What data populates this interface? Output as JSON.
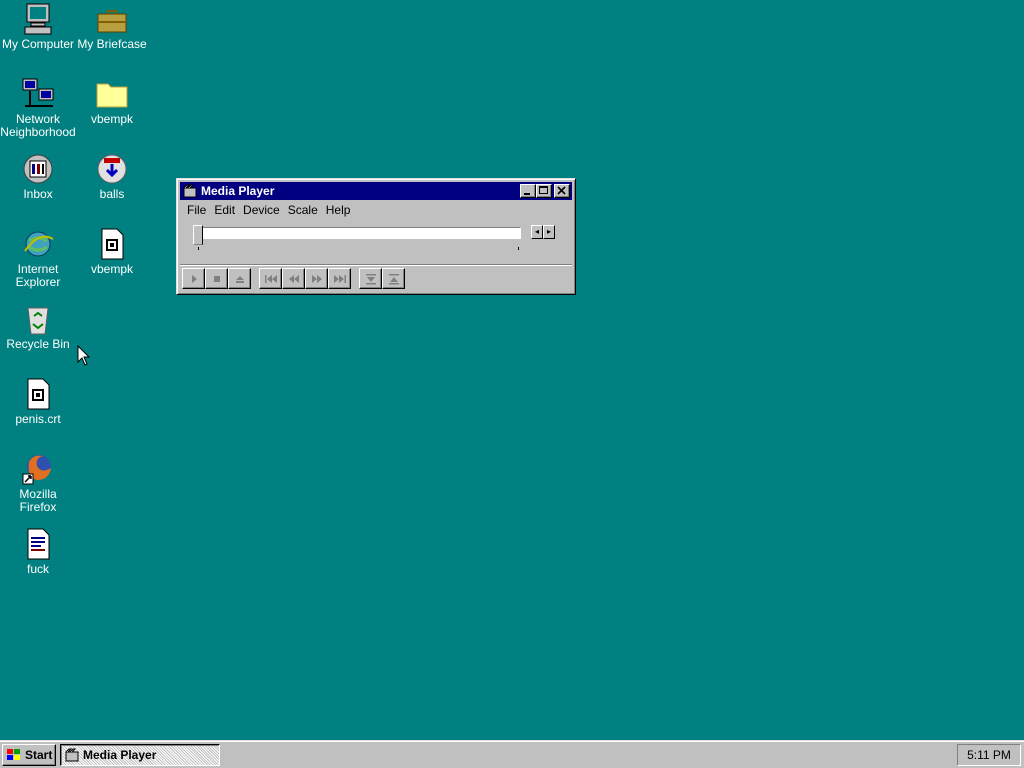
{
  "desktop": {
    "icons": [
      {
        "label": "My Computer",
        "icon": "computer-icon"
      },
      {
        "label": "My Briefcase",
        "icon": "briefcase-icon"
      },
      {
        "label": "Network Neighborhood",
        "icon": "network-icon"
      },
      {
        "label": "vbempk",
        "icon": "folder-icon"
      },
      {
        "label": "Inbox",
        "icon": "inbox-icon"
      },
      {
        "label": "balls",
        "icon": "installer-icon"
      },
      {
        "label": "Internet Explorer",
        "icon": "internet-explorer-icon"
      },
      {
        "label": "vbempk",
        "icon": "media-file-icon"
      },
      {
        "label": "Recycle Bin",
        "icon": "recycle-bin-icon"
      },
      {
        "label": "penis.crt",
        "icon": "media-file-icon"
      },
      {
        "label": "Mozilla Firefox",
        "icon": "firefox-shortcut-icon"
      },
      {
        "label": "fuck",
        "icon": "document-icon"
      }
    ],
    "background_color": "#008080"
  },
  "window": {
    "title": "Media Player",
    "menu": [
      "File",
      "Edit",
      "Device",
      "Scale",
      "Help"
    ],
    "transport_buttons": [
      "play",
      "stop",
      "eject",
      "previous-mark",
      "rewind",
      "fast-forward",
      "next-mark",
      "start-selection",
      "end-selection"
    ]
  },
  "taskbar": {
    "start_label": "Start",
    "task_label": "Media Player",
    "clock": "5:11 PM"
  }
}
